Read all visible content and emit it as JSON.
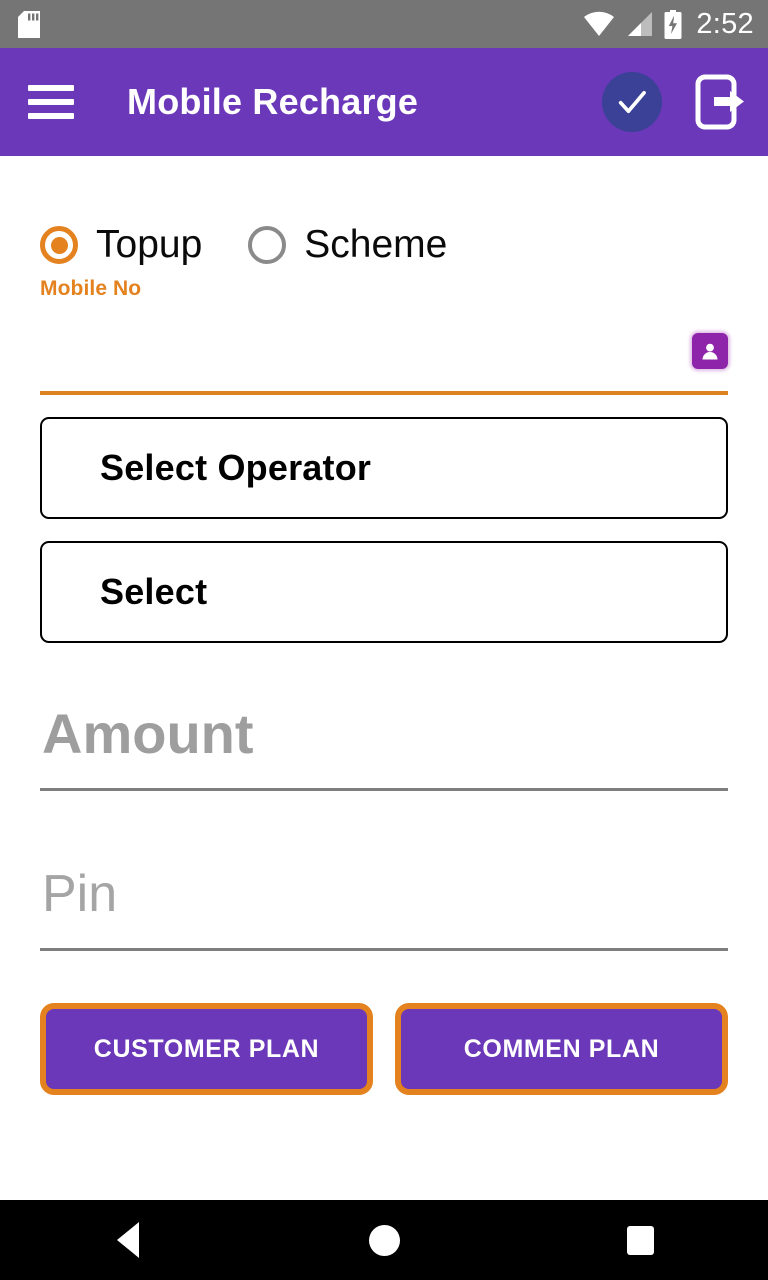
{
  "status_bar": {
    "time": "2:52",
    "icons": [
      "sd-card-icon",
      "wifi-icon",
      "signal-icon",
      "battery-charging-icon"
    ],
    "background": "#757575"
  },
  "app_bar": {
    "title": "Mobile Recharge",
    "menu_icon": "hamburger-menu-icon",
    "confirm_icon": "check-circle-icon",
    "logout_icon": "logout-icon",
    "background": "#6A38B8"
  },
  "form": {
    "recharge_type": {
      "options": [
        {
          "label": "Topup",
          "selected": true
        },
        {
          "label": "Scheme",
          "selected": false
        }
      ],
      "selected_color": "#E3821F",
      "unselected_color": "#8A8A8A"
    },
    "mobile_no": {
      "label": "Mobile No",
      "value": "",
      "placeholder": "",
      "underline_color": "#DD8220",
      "contact_icon": "contact-person-icon"
    },
    "operator": {
      "selected": "Select Operator"
    },
    "circle": {
      "selected": "Select"
    },
    "amount": {
      "value": "",
      "placeholder": "Amount"
    },
    "pin": {
      "value": "",
      "placeholder": "Pin"
    }
  },
  "actions": {
    "customer_plan": "CUSTOMER PLAN",
    "commen_plan": "COMMEN PLAN",
    "button_fill": "#6A38B8",
    "button_border": "#E3821F"
  },
  "nav_bar": {
    "back": "back-button",
    "home": "home-button",
    "recents": "recents-button"
  }
}
